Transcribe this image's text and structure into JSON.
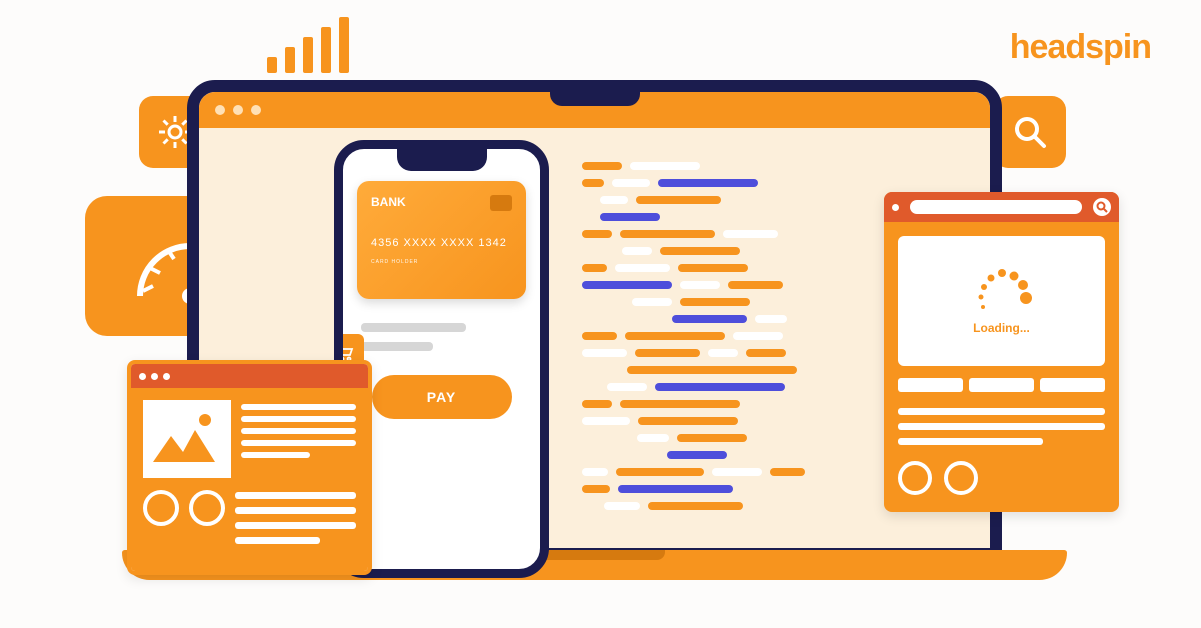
{
  "brand": {
    "logo_text": "headspin"
  },
  "phone": {
    "card_bank": "BANK",
    "card_number": "4356   XXXX   XXXX   1342",
    "card_holder_label": "CARD HOLDER",
    "pay_button": "PAY"
  },
  "loading": {
    "text": "Loading..."
  },
  "icons": {
    "gear": "gear-icon",
    "search": "search-icon",
    "cart": "cart-icon",
    "speedometer": "speedometer-icon",
    "signal": "signal-icon"
  },
  "colors": {
    "orange": "#f7941e",
    "navy": "#1b1c4e",
    "blue": "#4e4edb",
    "deep_orange": "#e05a2b"
  }
}
